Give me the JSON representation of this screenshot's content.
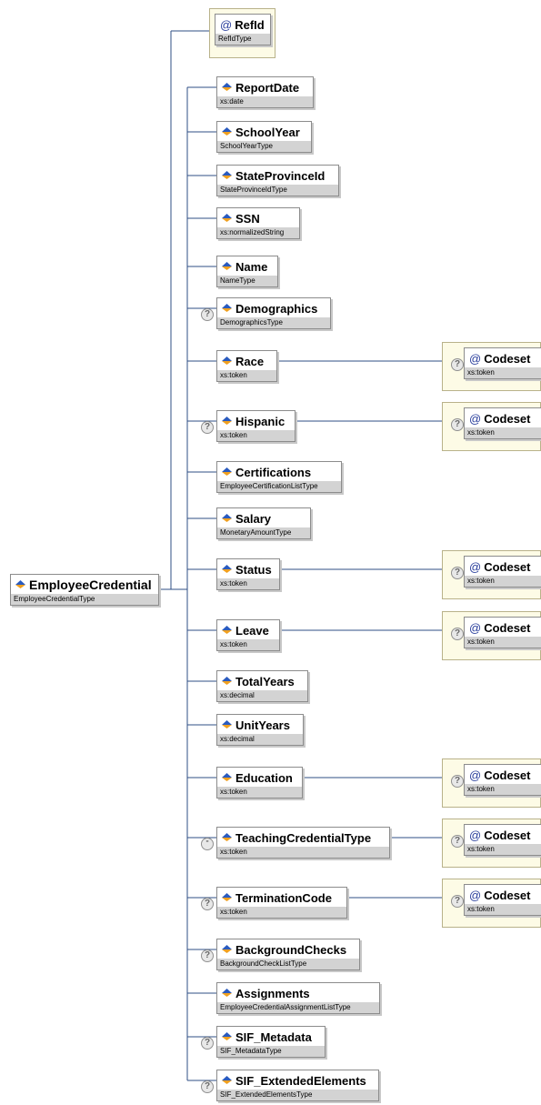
{
  "root": {
    "name": "EmployeeCredential",
    "type": "EmployeeCredentialType"
  },
  "attribute": {
    "name": "RefId",
    "type": "RefIdType"
  },
  "elements": [
    {
      "name": "ReportDate",
      "type": "xs:date",
      "optional": false
    },
    {
      "name": "SchoolYear",
      "type": "SchoolYearType",
      "optional": false
    },
    {
      "name": "StateProvinceId",
      "type": "StateProvinceIdType",
      "optional": false
    },
    {
      "name": "SSN",
      "type": "xs:normalizedString",
      "optional": false
    },
    {
      "name": "Name",
      "type": "NameType",
      "optional": false
    },
    {
      "name": "Demographics",
      "type": "DemographicsType",
      "optional": true
    },
    {
      "name": "Race",
      "type": "xs:token",
      "optional": false,
      "codeset": {
        "name": "Codeset",
        "type": "xs:token"
      }
    },
    {
      "name": "Hispanic",
      "type": "xs:token",
      "optional": true,
      "codeset": {
        "name": "Codeset",
        "type": "xs:token"
      }
    },
    {
      "name": "Certifications",
      "type": "EmployeeCertificationListType",
      "optional": false
    },
    {
      "name": "Salary",
      "type": "MonetaryAmountType",
      "optional": false
    },
    {
      "name": "Status",
      "type": "xs:token",
      "optional": false,
      "codeset": {
        "name": "Codeset",
        "type": "xs:token"
      }
    },
    {
      "name": "Leave",
      "type": "xs:token",
      "optional": false,
      "codeset": {
        "name": "Codeset",
        "type": "xs:token"
      }
    },
    {
      "name": "TotalYears",
      "type": "xs:decimal",
      "optional": false
    },
    {
      "name": "UnitYears",
      "type": "xs:decimal",
      "optional": false
    },
    {
      "name": "Education",
      "type": "xs:token",
      "optional": false,
      "codeset": {
        "name": "Codeset",
        "type": "xs:token"
      }
    },
    {
      "name": "TeachingCredentialType",
      "type": "xs:token",
      "optional": true,
      "marker": "\"",
      "codeset": {
        "name": "Codeset",
        "type": "xs:token"
      }
    },
    {
      "name": "TerminationCode",
      "type": "xs:token",
      "optional": true,
      "codeset": {
        "name": "Codeset",
        "type": "xs:token"
      }
    },
    {
      "name": "BackgroundChecks",
      "type": "BackgroundCheckListType",
      "optional": true
    },
    {
      "name": "Assignments",
      "type": "EmployeeCredentialAssignmentListType",
      "optional": false
    },
    {
      "name": "SIF_Metadata",
      "type": "SIF_MetadataType",
      "optional": true
    },
    {
      "name": "SIF_ExtendedElements",
      "type": "SIF_ExtendedElementsType",
      "optional": true
    }
  ],
  "icons": {
    "element": "element-diamond-icon",
    "attribute": "attribute-at-icon",
    "optional": "question-mark-icon",
    "attribute_symbol": "@",
    "optional_symbol": "?"
  },
  "colors": {
    "connector": "#2f4f86",
    "type_band": "#d3d3d3",
    "attribute_panel": "#fdfbe6",
    "icon_blue": "#2a5bbf",
    "icon_orange": "#f0a020"
  }
}
